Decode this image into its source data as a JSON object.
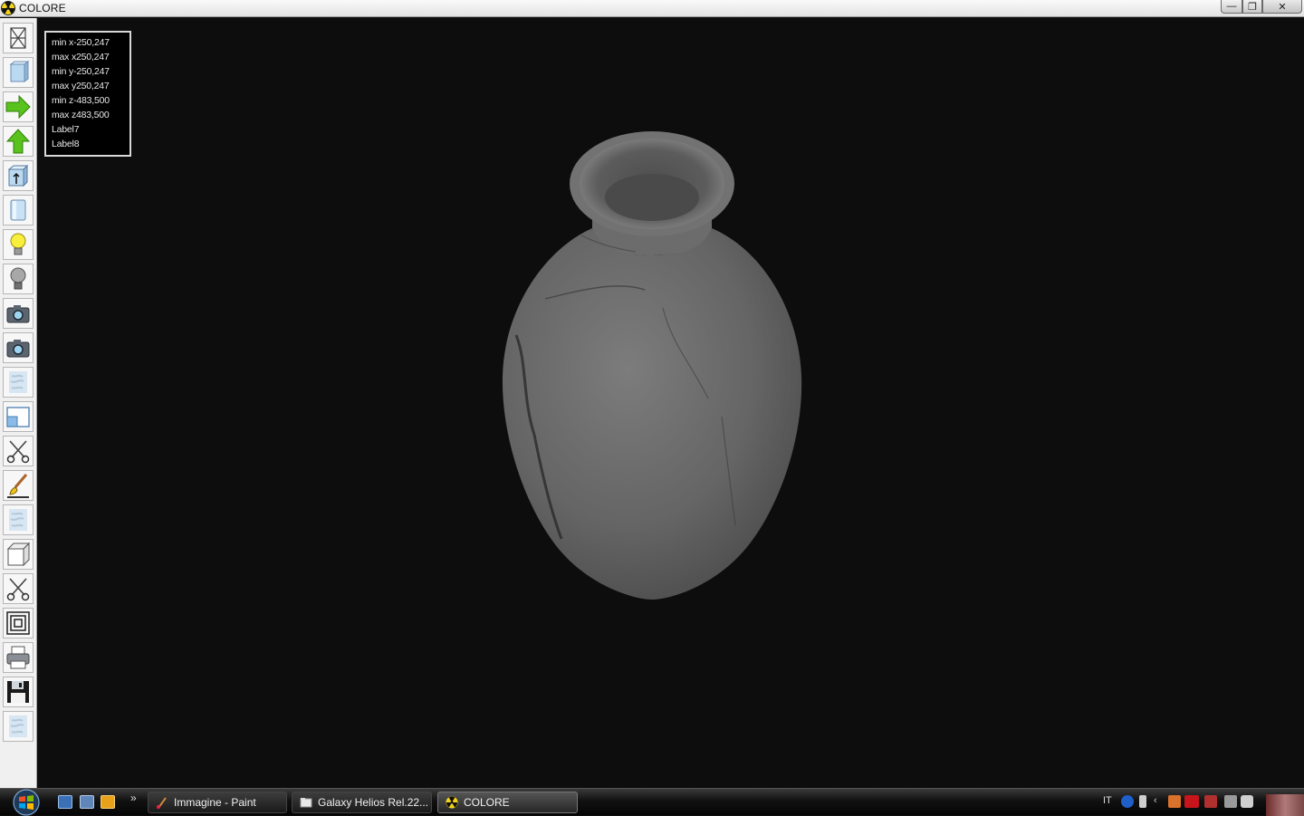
{
  "window": {
    "title": "COLORE",
    "minimize_glyph": "—",
    "maximize_glyph": "❐",
    "close_glyph": "✕"
  },
  "toolbar": {
    "tools": [
      {
        "icon": "wireframe-box-icon"
      },
      {
        "icon": "solid-box-icon"
      },
      {
        "icon": "arrow-right-icon"
      },
      {
        "icon": "arrow-up-icon"
      },
      {
        "icon": "box-up-icon"
      },
      {
        "icon": "cylinder-icon"
      },
      {
        "icon": "lightbulb-on-icon"
      },
      {
        "icon": "lightbulb-off-icon"
      },
      {
        "icon": "camera-icon"
      },
      {
        "icon": "camera-icon"
      },
      {
        "icon": "texture-icon"
      },
      {
        "icon": "window-icon"
      },
      {
        "icon": "scissors-icon"
      },
      {
        "icon": "brush-icon"
      },
      {
        "icon": "texture-icon"
      },
      {
        "icon": "cube-icon"
      },
      {
        "icon": "scissors-icon"
      },
      {
        "icon": "concentric-squares-icon"
      },
      {
        "icon": "printer-icon"
      },
      {
        "icon": "floppy-disk-icon"
      },
      {
        "icon": "texture-icon"
      }
    ]
  },
  "info": {
    "lines": [
      "min x-250,247",
      "max x250,247",
      "min y-250,247",
      "max y250,247",
      "min z-483,500",
      "max z483,500",
      "Label7",
      "Label8"
    ]
  },
  "taskbar": {
    "more_glyph": "»",
    "tasks": [
      {
        "label": "Immagine - Paint"
      },
      {
        "label": "Galaxy Helios  Rel.22..."
      },
      {
        "label": "COLORE"
      }
    ],
    "tray": {
      "language": "IT"
    }
  },
  "colors": {
    "viewport_bg": "#0d0d0d",
    "vase": "#6a6a6a",
    "toolbar_bg": "#f0f0f0"
  }
}
